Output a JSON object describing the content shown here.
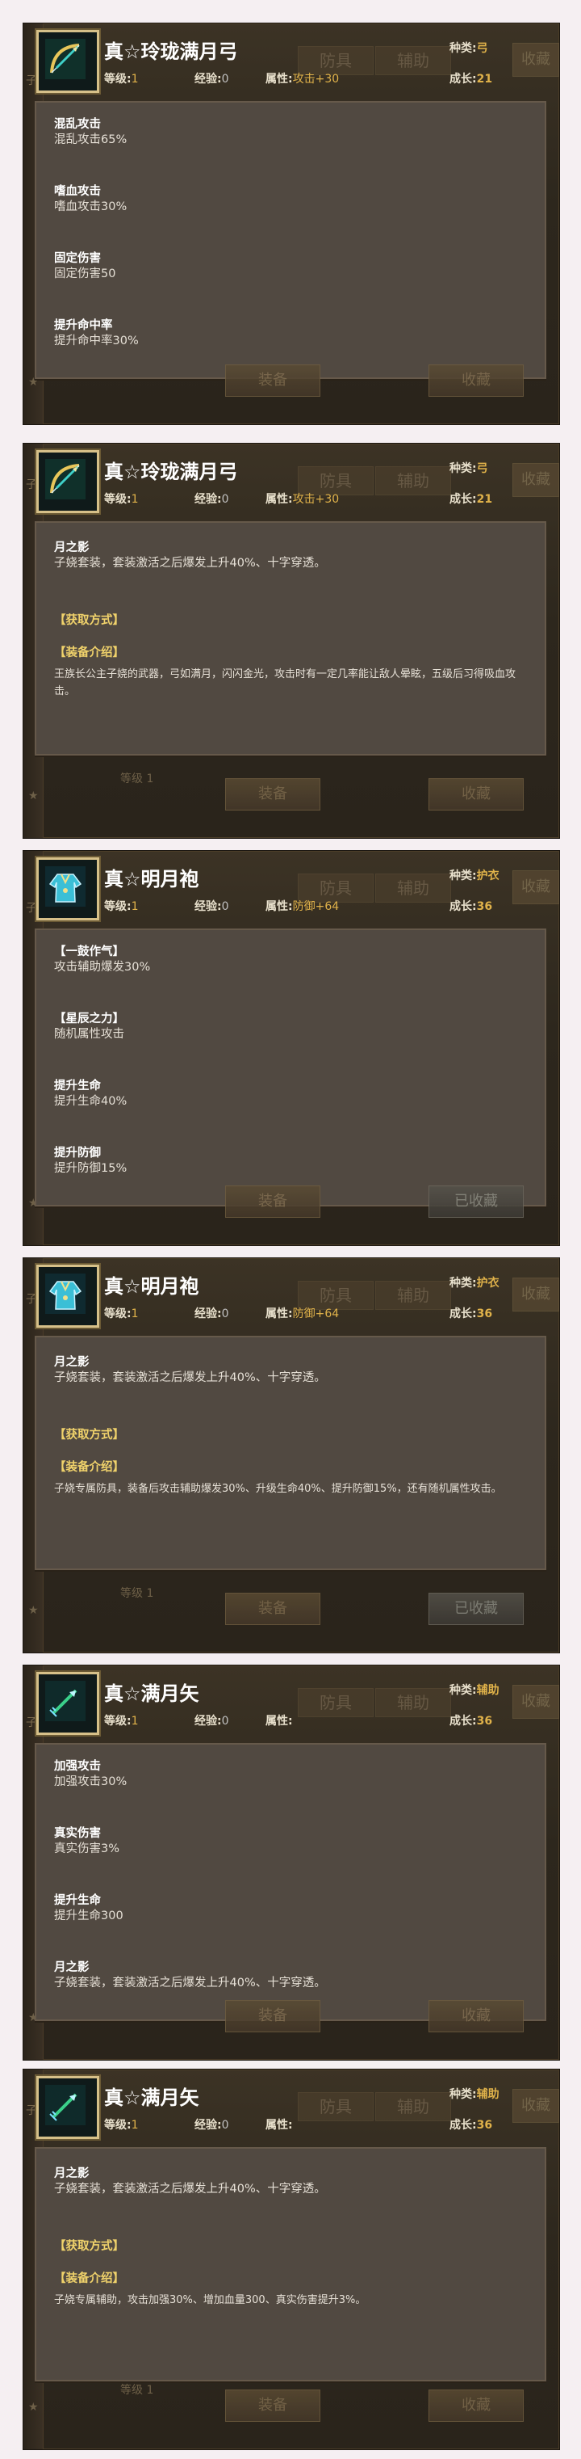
{
  "labels": {
    "kind": "种类:",
    "level": "等级:",
    "exp": "经验:",
    "attr": "属性:",
    "growth": "成长:"
  },
  "bg": {
    "tab_armor": "防具",
    "tab_aux": "辅助",
    "tab_collect": "收藏",
    "left_char": "子",
    "level_label": "等级 1",
    "star": "★"
  },
  "cards": [
    {
      "title": "真☆玲珑满月弓",
      "kind": "弓",
      "level": "1",
      "exp": "0",
      "attr": "攻击+30",
      "growth": "21",
      "icon": "bow-icon",
      "mode": "stats",
      "stats": [
        {
          "name": "混乱攻击",
          "value": "混乱攻击65%"
        },
        {
          "name": "嗜血攻击",
          "value": "嗜血攻击30%"
        },
        {
          "name": "固定伤害",
          "value": "固定伤害50"
        },
        {
          "name": "提升命中率",
          "value": "提升命中率30%"
        }
      ],
      "btn_left": "装备",
      "btn_right": "收藏"
    },
    {
      "title": "真☆玲珑满月弓",
      "kind": "弓",
      "level": "1",
      "exp": "0",
      "attr": "攻击+30",
      "growth": "21",
      "icon": "bow-icon",
      "mode": "info",
      "set_name": "月之影",
      "set_desc": "子娆套装，套装激活之后爆发上升40%、十字穿透。",
      "source": "【获取方式】",
      "intro_title": "【装备介绍】",
      "intro": "王族长公主子娆的武器，弓如满月，闪闪金光，攻击时有一定几率能让敌人晕眩，五级后习得吸血攻击。",
      "btn_left": "装备",
      "btn_right": "收藏"
    },
    {
      "title": "真☆明月袍",
      "kind": "护衣",
      "level": "1",
      "exp": "0",
      "attr": "防御+64",
      "growth": "36",
      "icon": "robe-icon",
      "mode": "stats",
      "stats": [
        {
          "name": "【一鼓作气】",
          "value": "攻击辅助爆发30%"
        },
        {
          "name": "【星辰之力】",
          "value": "随机属性攻击"
        },
        {
          "name": "提升生命",
          "value": "提升生命40%"
        },
        {
          "name": "提升防御",
          "value": "提升防御15%"
        }
      ],
      "btn_left": "装备",
      "btn_right": "已收藏"
    },
    {
      "title": "真☆明月袍",
      "kind": "护衣",
      "level": "1",
      "exp": "0",
      "attr": "防御+64",
      "growth": "36",
      "icon": "robe-icon",
      "mode": "info",
      "set_name": "月之影",
      "set_desc": "子娆套装，套装激活之后爆发上升40%、十字穿透。",
      "source": "【获取方式】",
      "intro_title": "【装备介绍】",
      "intro": "子娆专属防具，装备后攻击辅助爆发30%、升级生命40%、提升防御15%，还有随机属性攻击。",
      "btn_left": "装备",
      "btn_right": "已收藏"
    },
    {
      "title": "真☆满月矢",
      "kind": "辅助",
      "level": "1",
      "exp": "0",
      "attr": "",
      "growth": "36",
      "icon": "arrow-icon",
      "mode": "stats",
      "stats": [
        {
          "name": "加强攻击",
          "value": "加强攻击30%"
        },
        {
          "name": "真实伤害",
          "value": "真实伤害3%"
        },
        {
          "name": "提升生命",
          "value": "提升生命300"
        },
        {
          "name": "月之影",
          "value": "子娆套装，套装激活之后爆发上升40%、十字穿透。"
        }
      ],
      "btn_left": "装备",
      "btn_right": "收藏"
    },
    {
      "title": "真☆满月矢",
      "kind": "辅助",
      "level": "1",
      "exp": "0",
      "attr": "",
      "growth": "36",
      "icon": "arrow-icon",
      "mode": "info",
      "set_name": "月之影",
      "set_desc": "子娆套装，套装激活之后爆发上升40%、十字穿透。",
      "source": "【获取方式】",
      "intro_title": "【装备介绍】",
      "intro": "子娆专属辅助，攻击加强30%、增加血量300、真实伤害提升3%。",
      "btn_left": "装备",
      "btn_right": "收藏"
    }
  ]
}
